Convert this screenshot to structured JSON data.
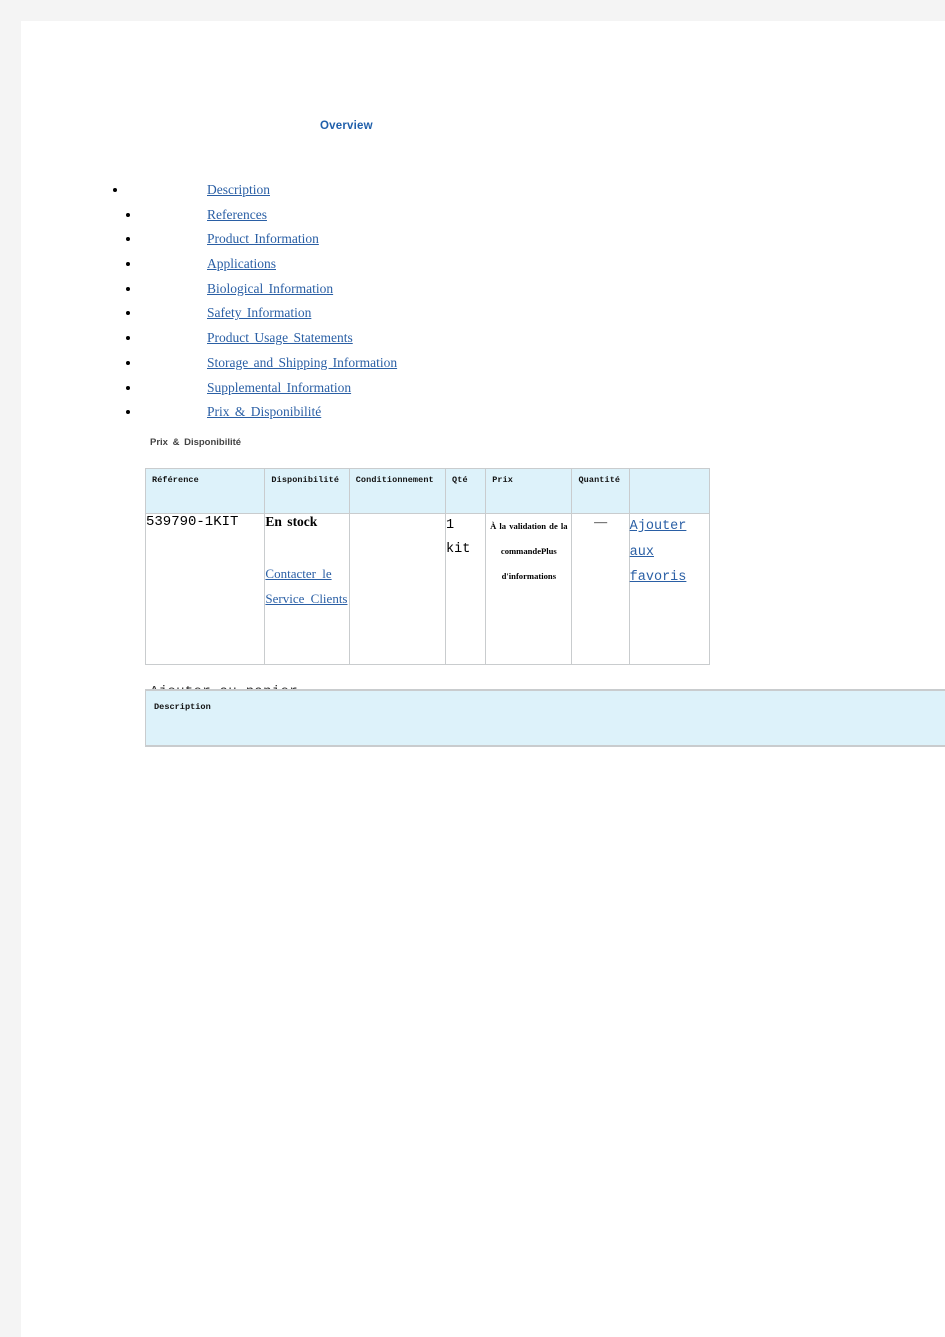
{
  "overview": {
    "title": "Overview",
    "items": [
      {
        "label": "Description"
      },
      {
        "label": "References"
      },
      {
        "label": "Product Information"
      },
      {
        "label": "Applications"
      },
      {
        "label": "Biological Information"
      },
      {
        "label": "Safety Information"
      },
      {
        "label": "Product Usage Statements"
      },
      {
        "label": "Storage and Shipping Information"
      },
      {
        "label": "Supplemental Information"
      },
      {
        "label": "Prix & Disponibilité"
      }
    ]
  },
  "pricing_section": {
    "label": "Prix & Disponibilité",
    "columns": [
      "Référence",
      "Disponibilité",
      "Conditionnement",
      "Qté",
      "Prix",
      "Quantité",
      ""
    ],
    "row": {
      "reference": "539790-1KIT",
      "availability_state": "En stock",
      "availability_link": "Contacter le Service Clients",
      "packaging": "",
      "qty_unit": "1 kit",
      "price": "À la validation de la commandePlus d'informations",
      "quantity": "—",
      "action_link": "Ajouter aux favoris"
    },
    "add_to_cart_label": "Ajouter au panier"
  },
  "description_panel": {
    "title": "Description"
  },
  "colors": {
    "link_blue": "#2a5fa5",
    "heading_blue": "#1f5fab",
    "table_header_bg": "#ddf2fa",
    "table_border": "#c9ccce",
    "page_gutter": "#f4f4f4"
  }
}
